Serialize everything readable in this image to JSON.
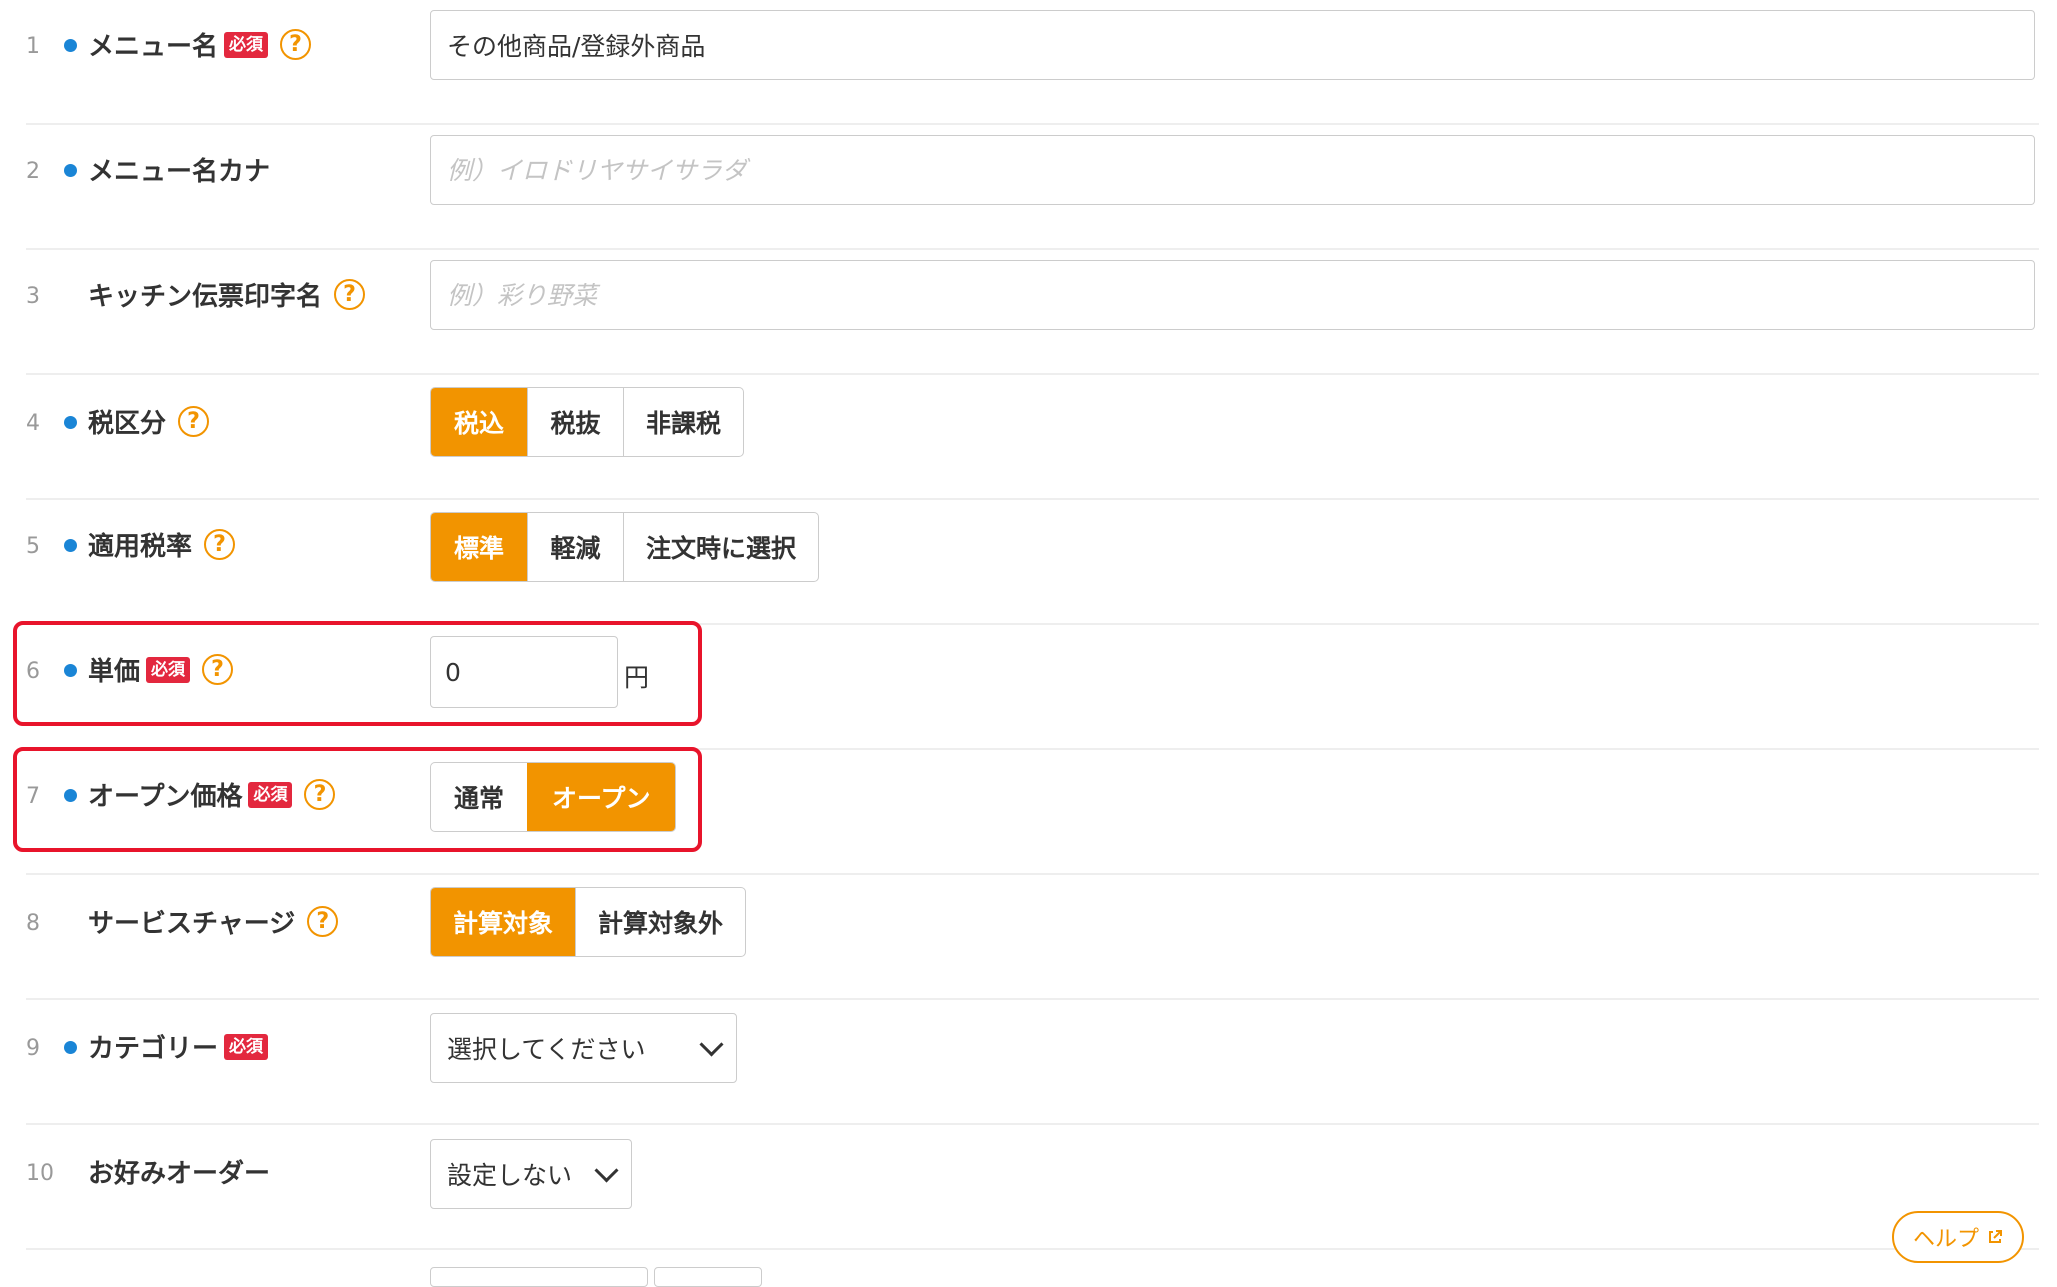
{
  "fields": [
    {
      "num": "1",
      "label": "メニュー名",
      "required": "必須",
      "help": "?",
      "value": "その他商品/登録外商品"
    },
    {
      "num": "2",
      "label": "メニュー名カナ",
      "placeholder": "例）イロドリヤサイサラダ"
    },
    {
      "num": "3",
      "label": "キッチン伝票印字名",
      "help": "?",
      "placeholder": "例）彩り野菜"
    },
    {
      "num": "4",
      "label": "税区分",
      "help": "?",
      "options": [
        "税込",
        "税抜",
        "非課税"
      ],
      "selected": "税込"
    },
    {
      "num": "5",
      "label": "適用税率",
      "help": "?",
      "options": [
        "標準",
        "軽減",
        "注文時に選択"
      ],
      "selected": "標準"
    },
    {
      "num": "6",
      "label": "単価",
      "required": "必須",
      "help": "?",
      "value": "0",
      "unit": "円"
    },
    {
      "num": "7",
      "label": "オープン価格",
      "required": "必須",
      "help": "?",
      "options": [
        "通常",
        "オープン"
      ],
      "selected": "オープン"
    },
    {
      "num": "8",
      "label": "サービスチャージ",
      "help": "?",
      "options": [
        "計算対象",
        "計算対象外"
      ],
      "selected": "計算対象"
    },
    {
      "num": "9",
      "label": "カテゴリー",
      "required": "必須",
      "select_value": "選択してください"
    },
    {
      "num": "10",
      "label": "お好みオーダー",
      "select_value": "設定しない"
    }
  ],
  "help_button": {
    "label": "ヘルプ"
  },
  "colors": {
    "accent": "#f29400",
    "required": "#e3283e",
    "dot": "#1a85d6",
    "highlight": "#e8142b"
  }
}
